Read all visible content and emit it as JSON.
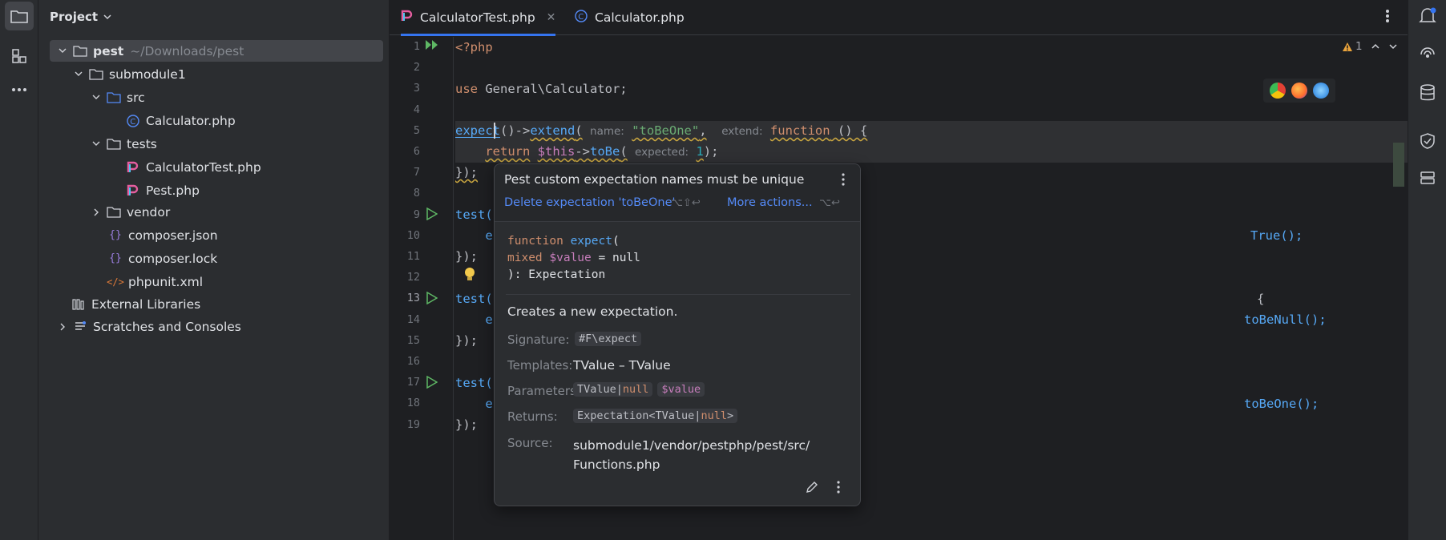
{
  "project": {
    "header": "Project",
    "tree": [
      {
        "label": "pest",
        "suffix": "~/Downloads/pest"
      },
      {
        "label": "submodule1"
      },
      {
        "label": "src"
      },
      {
        "label": "Calculator.php"
      },
      {
        "label": "tests"
      },
      {
        "label": "CalculatorTest.php"
      },
      {
        "label": "Pest.php"
      },
      {
        "label": "vendor"
      },
      {
        "label": "composer.json"
      },
      {
        "label": "composer.lock"
      },
      {
        "label": "phpunit.xml"
      },
      {
        "label": "External Libraries"
      },
      {
        "label": "Scratches and Consoles"
      }
    ]
  },
  "tabs": [
    {
      "label": "CalculatorTest.php",
      "active": true
    },
    {
      "label": "Calculator.php",
      "active": false
    }
  ],
  "editor": {
    "warning_count": "1",
    "line_numbers": [
      "1",
      "2",
      "3",
      "4",
      "5",
      "6",
      "7",
      "8",
      "9",
      "10",
      "11",
      "12",
      "13",
      "14",
      "15",
      "16",
      "17",
      "18",
      "19"
    ],
    "code": {
      "l1": "<?php",
      "l3_kw": "use",
      "l3_rest": " General\\Calculator;",
      "l5_fn": "expect",
      "l5_mid": "()->",
      "l5_fn2": "extend",
      "l5_paren": "(",
      "l5_hint1": "name:",
      "l5_str": "\"toBeOne\"",
      "l5_comma": ",",
      "l5_hint2": "extend:",
      "l5_kw": "function",
      "l5_end": " () {",
      "l6_kw": "return",
      "l6_var": "$this",
      "l6_arrow": "->",
      "l6_fn": "toBe",
      "l6_paren": "(",
      "l6_hint": "expected:",
      "l6_num": "1",
      "l6_end": ");",
      "l7": "});",
      "l9": "test(",
      "l10_a": "e",
      "l10_b": "True();",
      "l11": "});",
      "l13": "test(",
      "l13_b": "{",
      "l14_a": "e",
      "l14_b": "toBeNull();",
      "l15": "});",
      "l17": "test(",
      "l18_a": "e",
      "l18_b": "toBeOne();",
      "l19": "});"
    }
  },
  "popup": {
    "title": "Pest custom expectation names must be unique",
    "action_delete": "Delete expectation 'toBeOne'",
    "action_delete_shortcut": "⌥⇧↩",
    "action_more": "More actions...",
    "action_more_shortcut": "⌥↩",
    "sig_line1_kw": "function",
    "sig_line1_fn": "expect",
    "sig_line1_paren": "(",
    "sig_line2_type": "mixed",
    "sig_line2_var": "$value",
    "sig_line2_rest": " = null",
    "sig_line3": "): Expectation",
    "description": "Creates a new expectation.",
    "signature_label": "Signature:",
    "signature_value": "#F\\expect",
    "templates_label": "Templates:",
    "templates_value": "TValue – TValue",
    "parameters_label": "Parameters:",
    "param_type_a": "TValue|",
    "param_type_b": "null",
    "param_name": "$value",
    "returns_label": "Returns:",
    "returns_a": "Expectation<TValue|",
    "returns_b": "null",
    "returns_c": ">",
    "source_label": "Source:",
    "source_line1": "submodule1/vendor/pestphp/pest/src/",
    "source_line2": "Functions.php"
  },
  "colors": {
    "accent": "#3574f0",
    "keyword": "#cf8e6d",
    "function": "#56a8f5",
    "string": "#6aab73",
    "warning": "#e9a33c"
  }
}
